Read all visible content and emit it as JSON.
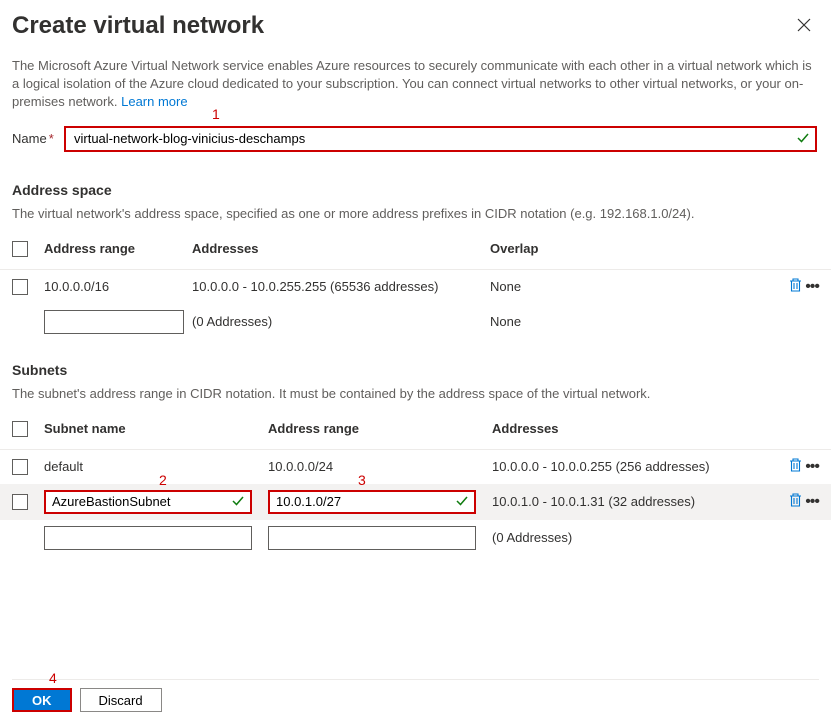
{
  "header": {
    "title": "Create virtual network"
  },
  "description": {
    "text": "The Microsoft Azure Virtual Network service enables Azure resources to securely communicate with each other in a virtual network which is a logical isolation of the Azure cloud dedicated to your subscription. You can connect virtual networks to other virtual networks, or your on-premises network.",
    "learn_more": "Learn more"
  },
  "form": {
    "name_label": "Name",
    "name_value": "virtual-network-blog-vinicius-deschamps"
  },
  "callouts": {
    "c1": "1",
    "c2": "2",
    "c3": "3",
    "c4": "4"
  },
  "address_space": {
    "title": "Address space",
    "description": "The virtual network's address space, specified as one or more address prefixes in CIDR notation (e.g. 192.168.1.0/24).",
    "headers": {
      "range": "Address range",
      "addresses": "Addresses",
      "overlap": "Overlap"
    },
    "rows": [
      {
        "range": "10.0.0.0/16",
        "addresses": "10.0.0.0 - 10.0.255.255 (65536 addresses)",
        "overlap": "None"
      }
    ],
    "empty_row": {
      "addresses": "(0 Addresses)",
      "overlap": "None"
    }
  },
  "subnets": {
    "title": "Subnets",
    "description": "The subnet's address range in CIDR notation. It must be contained by the address space of the virtual network.",
    "headers": {
      "name": "Subnet name",
      "range": "Address range",
      "addresses": "Addresses"
    },
    "rows": [
      {
        "name": "default",
        "range": "10.0.0.0/24",
        "addresses": "10.0.0.0 - 10.0.0.255 (256 addresses)"
      },
      {
        "name": "AzureBastionSubnet",
        "range": "10.0.1.0/27",
        "addresses": "10.0.1.0 - 10.0.1.31 (32 addresses)"
      }
    ],
    "empty_row": {
      "addresses": "(0 Addresses)"
    }
  },
  "footer": {
    "ok": "OK",
    "discard": "Discard"
  }
}
